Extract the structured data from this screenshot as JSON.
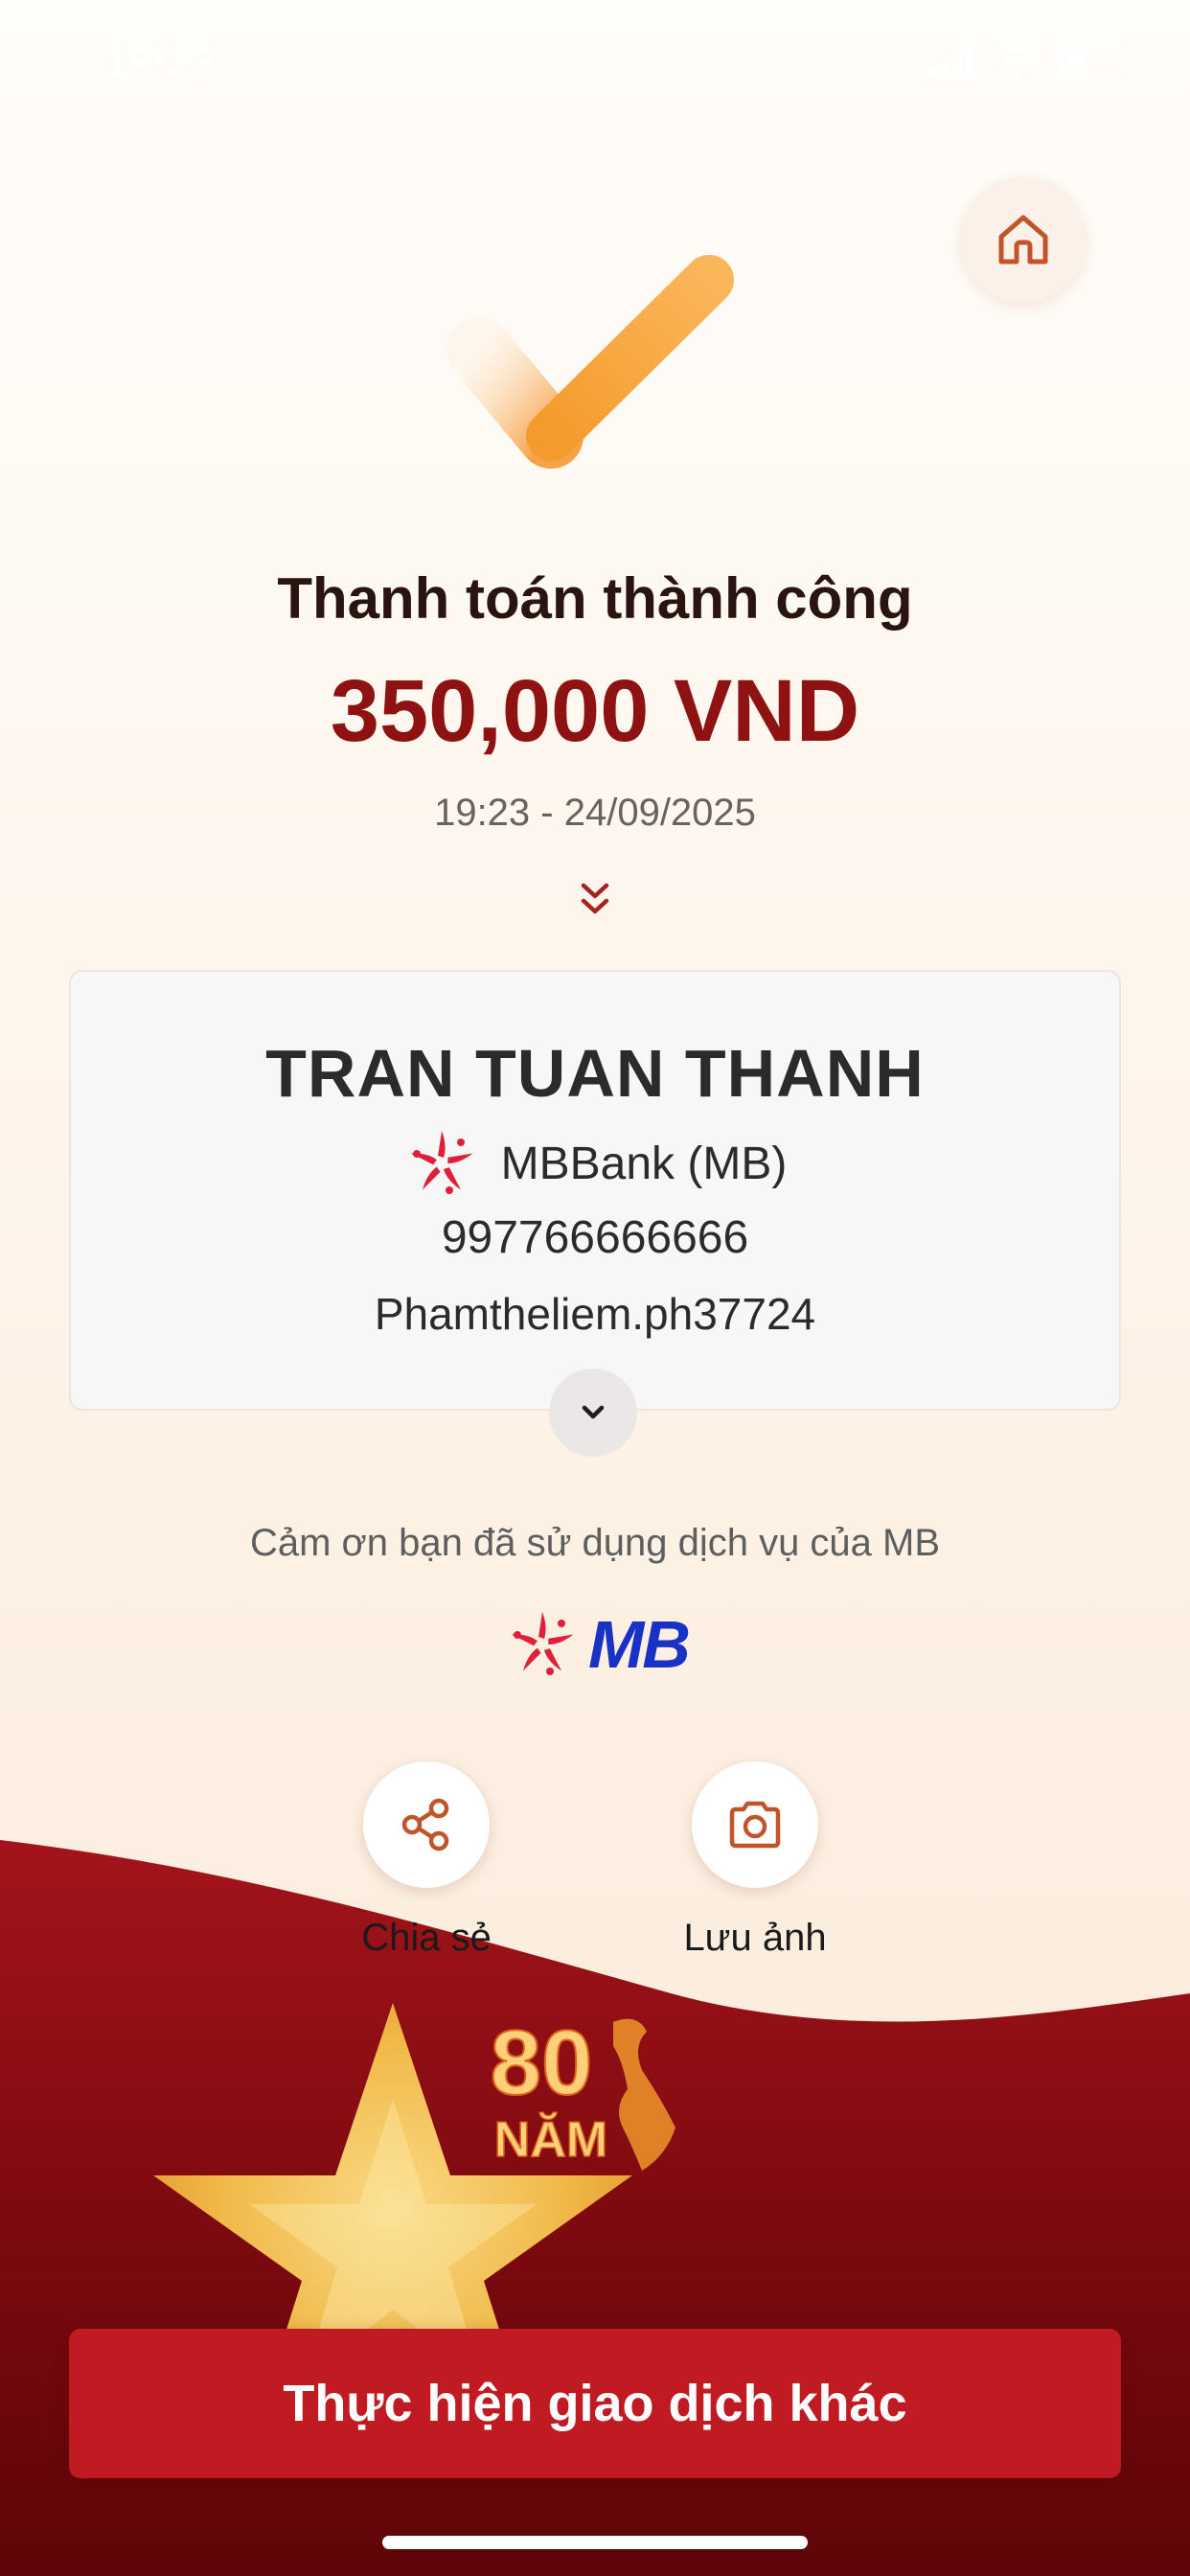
{
  "status_bar": {
    "time": "19:23"
  },
  "header": {
    "home_icon": "home-icon",
    "check_icon": "checkmark-icon"
  },
  "result": {
    "title": "Thanh toán thành công",
    "amount": "350,000 VND",
    "datetime": "19:23 - 24/09/2025"
  },
  "recipient": {
    "name": "TRAN TUAN THANH",
    "bank": "MBBank (MB)",
    "account_number": "997766666666",
    "content": "Phamtheliem.ph37724"
  },
  "footer": {
    "thanks": "Cảm ơn bạn đã sử dụng dịch vụ của MB",
    "logo_text": "MB"
  },
  "actions": [
    {
      "label": "Chia sẻ",
      "icon": "share-icon"
    },
    {
      "label": "Lưu ảnh",
      "icon": "camera-icon"
    }
  ],
  "banner": {
    "number": "80",
    "word": "NĂM"
  },
  "primary_button": {
    "label": "Thực hiện giao dịch khác"
  },
  "colors": {
    "brand_red": "#c01a22",
    "amount_red": "#8f1212",
    "mb_blue": "#1a31c6",
    "check_orange": "#f8a13b"
  }
}
